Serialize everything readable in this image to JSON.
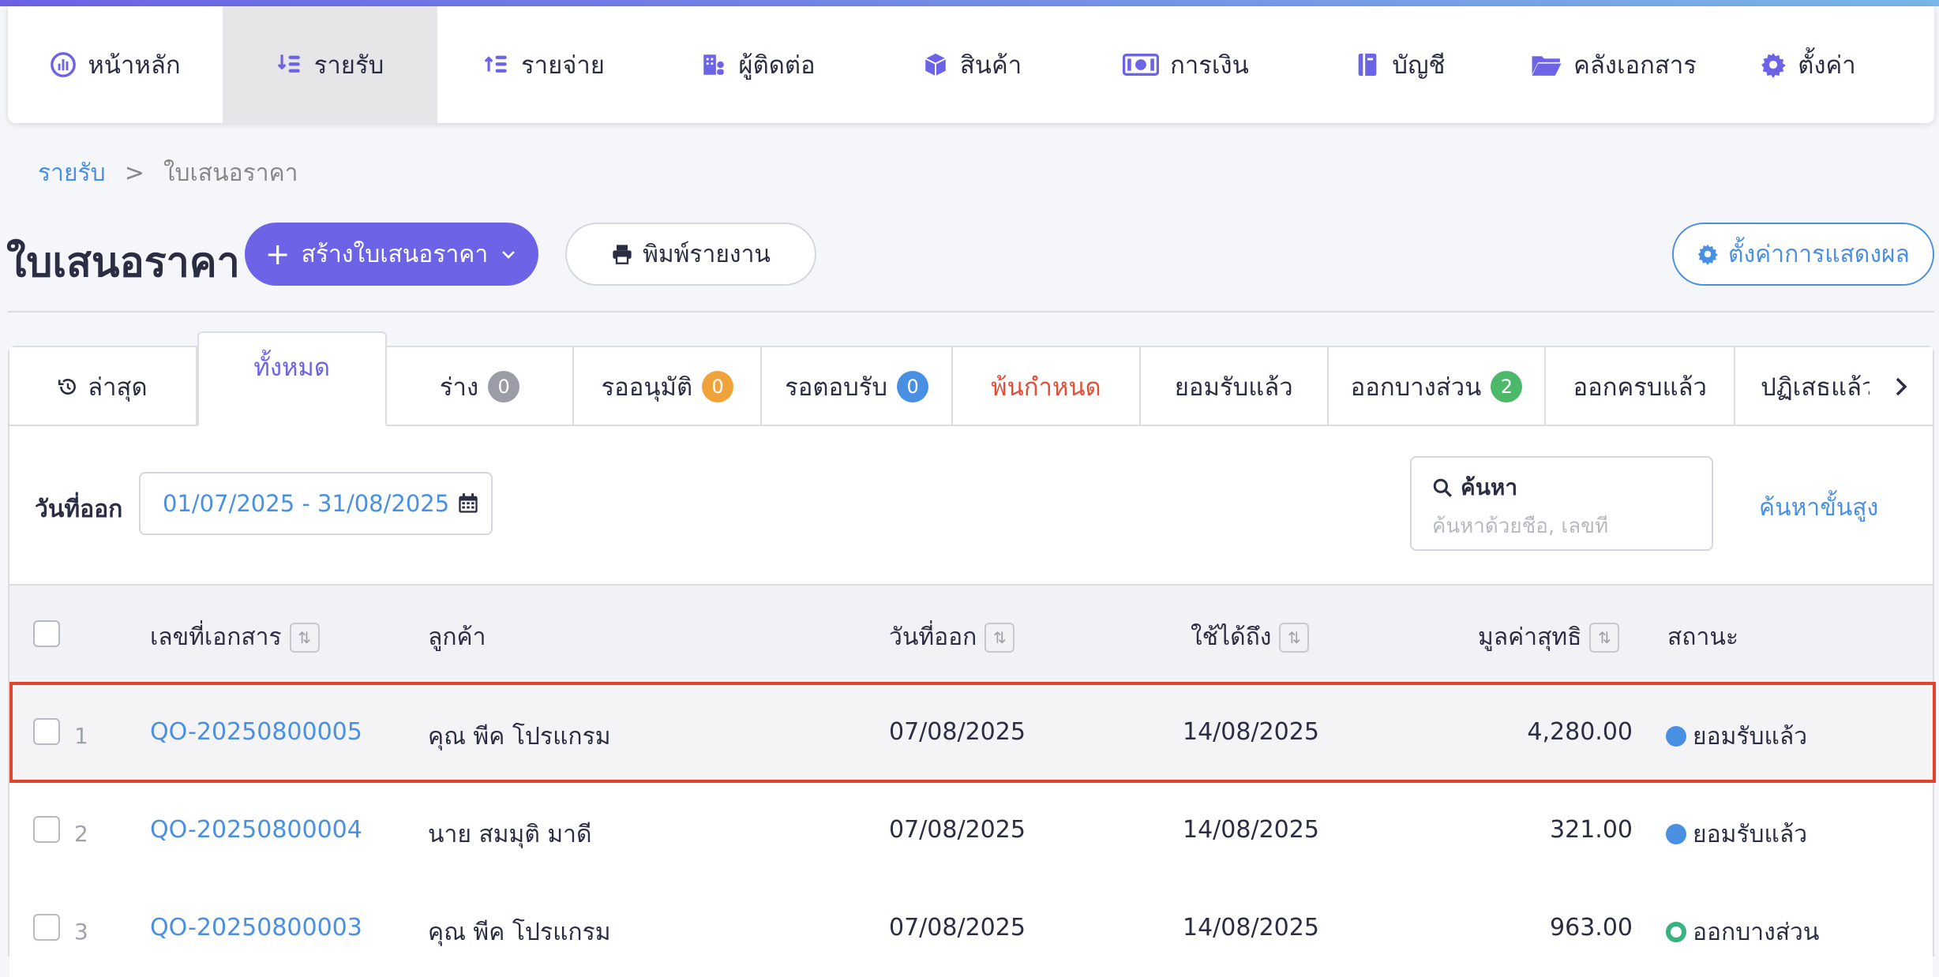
{
  "nav": {
    "items": [
      {
        "label": "หน้าหลัก",
        "icon": "dashboard-icon"
      },
      {
        "label": "รายรับ",
        "icon": "income-icon"
      },
      {
        "label": "รายจ่าย",
        "icon": "expense-icon"
      },
      {
        "label": "ผู้ติดต่อ",
        "icon": "contacts-icon"
      },
      {
        "label": "สินค้า",
        "icon": "product-box-icon"
      },
      {
        "label": "การเงิน",
        "icon": "money-icon"
      },
      {
        "label": "บัญชี",
        "icon": "accounting-book-icon"
      },
      {
        "label": "คลังเอกสาร",
        "icon": "folder-icon"
      },
      {
        "label": "ตั้งค่า",
        "icon": "gear-icon"
      }
    ],
    "active_index": 1,
    "accent_color": "#6c63e6"
  },
  "breadcrumb": {
    "parent": "รายรับ",
    "separator": ">",
    "current": "ใบเสนอราคา"
  },
  "header": {
    "title": "ใบเสนอราคา",
    "create_label": "สร้างใบเสนอราคา",
    "print_label": "พิมพ์รายงาน",
    "display_settings_label": "ตั้งค่าการแสดงผล"
  },
  "tabs": [
    {
      "label": "ล่าสุด"
    },
    {
      "label": "ทั้งหมด"
    },
    {
      "label": "ร่าง",
      "count": "0",
      "badge_color": "#9a9ca6"
    },
    {
      "label": "รออนุมัติ",
      "count": "0",
      "badge_color": "#f0a33a"
    },
    {
      "label": "รอตอบรับ",
      "count": "0",
      "badge_color": "#4a90e2"
    },
    {
      "label": "พ้นกำหนด"
    },
    {
      "label": "ยอมรับแล้ว"
    },
    {
      "label": "ออกบางส่วน",
      "count": "2",
      "badge_color": "#4cb86a"
    },
    {
      "label": "ออกครบแล้ว"
    },
    {
      "label": "ปฏิเสธแล้ว"
    }
  ],
  "filter": {
    "date_label": "วันที่ออก",
    "date_range": "01/07/2025 - 31/08/2025",
    "search_title": "ค้นหา",
    "search_placeholder": "ค้นหาด้วยชื่อ, เลขที่",
    "advanced_search": "ค้นหาขั้นสูง"
  },
  "table": {
    "columns": {
      "doc_no": "เลขที่เอกสาร",
      "customer": "ลูกค้า",
      "issue_date": "วันที่ออก",
      "valid_until": "ใช้ได้ถึง",
      "net_value": "มูลค่าสุทธิ",
      "status": "สถานะ"
    },
    "rows": [
      {
        "num": "1",
        "doc_no": "QO-20250800005",
        "customer": "คุณ พีค โปรแกรม",
        "issue_date": "07/08/2025",
        "valid_until": "14/08/2025",
        "net_value": "4,280.00",
        "status": "ยอมรับแล้ว",
        "status_color": "#4a90e2"
      },
      {
        "num": "2",
        "doc_no": "QO-20250800004",
        "customer": "นาย สมมุติ มาดี",
        "issue_date": "07/08/2025",
        "valid_until": "14/08/2025",
        "net_value": "321.00",
        "status": "ยอมรับแล้ว",
        "status_color": "#4a90e2"
      },
      {
        "num": "3",
        "doc_no": "QO-20250800003",
        "customer": "คุณ พีค โปรแกรม",
        "issue_date": "07/08/2025",
        "valid_until": "14/08/2025",
        "net_value": "963.00",
        "status": "ออกบางส่วน",
        "status_color": "#36b37e"
      }
    ]
  }
}
